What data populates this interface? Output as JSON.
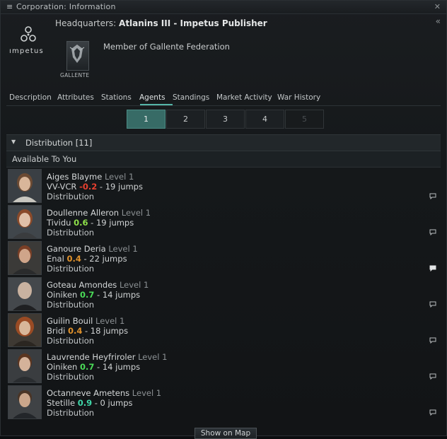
{
  "window": {
    "title": "Corporation: Information"
  },
  "corp": {
    "logo_text": "ımpetus",
    "hq_label": "Headquarters:",
    "hq_value": "Atlanins III - Impetus Publisher",
    "faction_label": "GALLENTE",
    "member_text": "Member of Gallente Federation"
  },
  "tabs": [
    {
      "label": "Description",
      "active": false
    },
    {
      "label": "Attributes",
      "active": false
    },
    {
      "label": "Stations",
      "active": false
    },
    {
      "label": "Agents",
      "active": true
    },
    {
      "label": "Standings",
      "active": false
    },
    {
      "label": "Market Activity",
      "active": false
    },
    {
      "label": "War History",
      "active": false
    }
  ],
  "pager": {
    "pages": [
      "1",
      "2",
      "3",
      "4",
      "5"
    ],
    "current": "1",
    "disabled": "5"
  },
  "section": {
    "title": "Distribution [11]",
    "subtitle": "Available To You"
  },
  "agents": [
    {
      "name": "Aiges Blayme",
      "level": "Level 1",
      "system": "VV-VCR",
      "security": "-0.2",
      "sec_color": "#e8402f",
      "jumps": "- 19 jumps",
      "division": "Distribution"
    },
    {
      "name": "Doullenne Alleron",
      "level": "Level 1",
      "system": "Tividu",
      "security": "0.6",
      "sec_color": "#8ee04a",
      "jumps": "- 19 jumps",
      "division": "Distribution"
    },
    {
      "name": "Ganoure Deria",
      "level": "Level 1",
      "system": "Enal",
      "security": "0.4",
      "sec_color": "#e0922c",
      "jumps": "- 22 jumps",
      "division": "Distribution"
    },
    {
      "name": "Goteau Amondes",
      "level": "Level 1",
      "system": "Oiniken",
      "security": "0.7",
      "sec_color": "#4bdc58",
      "jumps": "- 14 jumps",
      "division": "Distribution"
    },
    {
      "name": "Guilin Bouil",
      "level": "Level 1",
      "system": "Bridi",
      "security": "0.4",
      "sec_color": "#e0922c",
      "jumps": "- 18 jumps",
      "division": "Distribution"
    },
    {
      "name": "Lauvrende Heyfriroler",
      "level": "Level 1",
      "system": "Oiniken",
      "security": "0.7",
      "sec_color": "#4bdc58",
      "jumps": "- 14 jumps",
      "division": "Distribution"
    },
    {
      "name": "Octanneve Ametens",
      "level": "Level 1",
      "system": "Stetille",
      "security": "0.9",
      "sec_color": "#3fd6a8",
      "jumps": "- 0 jumps",
      "division": "Distribution"
    }
  ],
  "footer": {
    "map_button": "Show on Map"
  },
  "icons": {
    "menu": "menu-icon",
    "close": "close-icon",
    "collapse": "collapse-icon",
    "chat": "chat-icon"
  }
}
